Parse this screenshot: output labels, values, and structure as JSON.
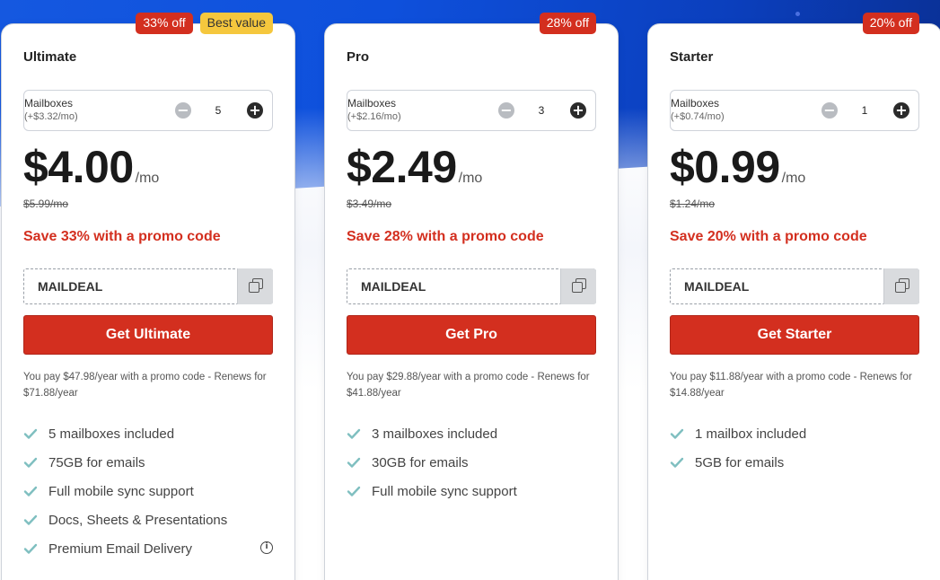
{
  "colors": {
    "accent": "#d32f1f",
    "best_badge": "#f5c73d",
    "hero_blue": "#0e50dc",
    "check": "#7fbfc0"
  },
  "plans": [
    {
      "name": "Ultimate",
      "badges": [
        "33% off",
        "Best value"
      ],
      "mailboxes_label": "Mailboxes",
      "mailboxes_sub": "(+$3.32/mo)",
      "mailbox_count": "5",
      "price": "$4.00",
      "per": "/mo",
      "old_price": "$5.99/mo",
      "save_text": "Save 33% with a promo code",
      "promo_code": "MAILDEAL",
      "cta": "Get Ultimate",
      "note": "You pay $47.98/year with a promo code - Renews for $71.88/year",
      "features": [
        "5 mailboxes included",
        "75GB for emails",
        "Full mobile sync support",
        "Docs, Sheets & Presentations",
        "Premium Email Delivery"
      ]
    },
    {
      "name": "Pro",
      "badges": [
        "28% off"
      ],
      "mailboxes_label": "Mailboxes",
      "mailboxes_sub": "(+$2.16/mo)",
      "mailbox_count": "3",
      "price": "$2.49",
      "per": "/mo",
      "old_price": "$3.49/mo",
      "save_text": "Save 28% with a promo code",
      "promo_code": "MAILDEAL",
      "cta": "Get Pro",
      "note": "You pay $29.88/year with a promo code - Renews for $41.88/year",
      "features": [
        "3 mailboxes included",
        "30GB for emails",
        "Full mobile sync support"
      ]
    },
    {
      "name": "Starter",
      "badges": [
        "20% off"
      ],
      "mailboxes_label": "Mailboxes",
      "mailboxes_sub": "(+$0.74/mo)",
      "mailbox_count": "1",
      "price": "$0.99",
      "per": "/mo",
      "old_price": "$1.24/mo",
      "save_text": "Save 20% with a promo code",
      "promo_code": "MAILDEAL",
      "cta": "Get Starter",
      "note": "You pay $11.88/year with a promo code - Renews for $14.88/year",
      "features": [
        "1 mailbox included",
        "5GB for emails"
      ]
    }
  ]
}
